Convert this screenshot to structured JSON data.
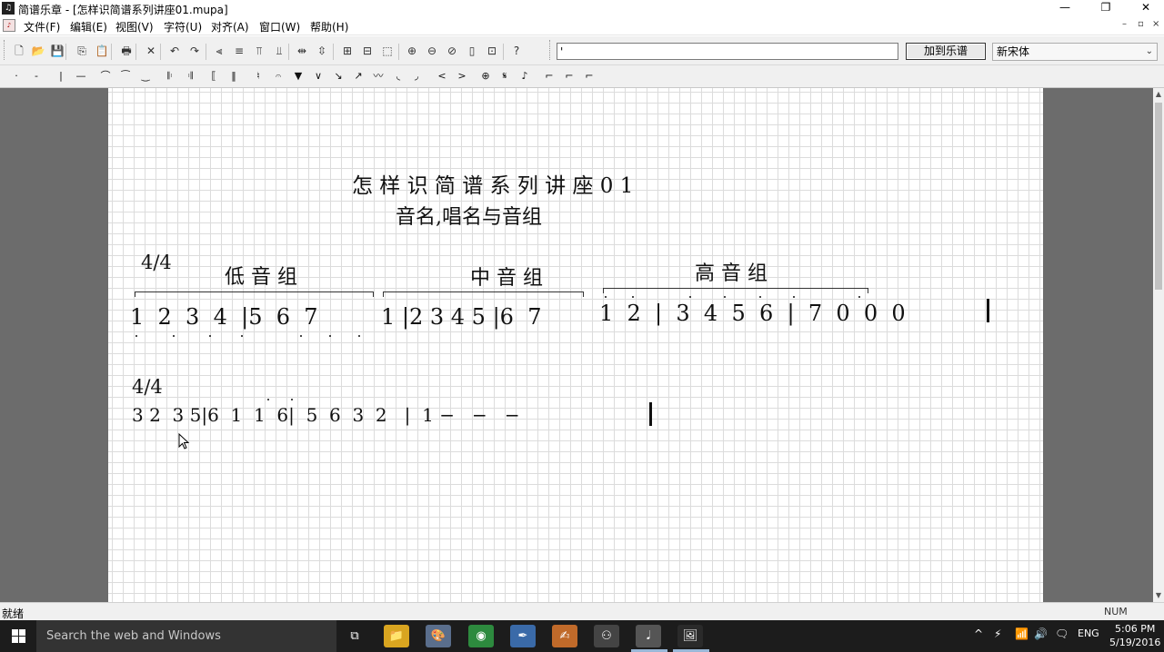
{
  "window": {
    "title": "简谱乐章 - [怎样识简谱系列讲座01.mupa]",
    "app_icon": "app-logo-icon",
    "controls": {
      "minimize": "—",
      "restore": "❐",
      "close": "✕"
    }
  },
  "menu": {
    "items": [
      "文件(F)",
      "编辑(E)",
      "视图(V)",
      "字符(U)",
      "对齐(A)",
      "窗口(W)",
      "帮助(H)"
    ],
    "mdi": {
      "minimize": "–",
      "restore": "▫",
      "close": "×"
    }
  },
  "toolbar1": {
    "icons": [
      "new-file-icon",
      "open-folder-icon",
      "save-icon",
      "copy-icon",
      "paste-icon",
      "print-icon",
      "delete-icon",
      "undo-icon",
      "redo-icon",
      "align-left-icon",
      "align-center-icon",
      "align-top-icon",
      "align-bottom-icon",
      "distribute-h-icon",
      "distribute-v-icon",
      "group-icon",
      "ungroup-icon",
      "select-all-icon",
      "zoom-in-icon",
      "zoom-out-icon",
      "zoom-reset-icon",
      "page-icon",
      "fit-icon",
      "help-icon"
    ],
    "glyphs": [
      "🗋",
      "📂",
      "💾",
      "⎘",
      "📋",
      "🖶",
      "✕",
      "↶",
      "↷",
      "⫷",
      "≡",
      "⫪",
      "⫫",
      "⇹",
      "⇳",
      "⊞",
      "⊟",
      "⬚",
      "⊕",
      "⊖",
      "⊘",
      "▯",
      "⊡",
      "?"
    ],
    "text_input_value": "'",
    "add_button_label": "加到乐谱",
    "font_select_value": "新宋体"
  },
  "toolbar2": {
    "symbols": [
      "·",
      "-",
      "|",
      "—",
      "⌒",
      "⁀",
      "‿",
      "𝄆",
      "𝄇",
      "⟦",
      "‖",
      "♮",
      "𝄐",
      "▼",
      "∨",
      "↘",
      "↗",
      "〰",
      "◟",
      "◞",
      "<",
      ">",
      "⊕",
      "𝄋",
      "♪",
      "⌐",
      "⌐",
      "⌐"
    ]
  },
  "score": {
    "title": "怎 样 识 简 谱 系 列 讲 座 0 1",
    "subtitle": "音名,唱名与音组",
    "time_sig_1": "4/4",
    "group_low": "低 音 组",
    "group_mid": "中 音 组",
    "group_high": "高 音 组",
    "line1": {
      "low": "1  2  3  4  |5  6  7",
      "mid": "1 |2 3 4 5 |6  7",
      "high": "1  2  |  3  4  5  6  |  7  0  0  0"
    },
    "time_sig_2": "4/4",
    "line2": "3 2  3 5|6  1  1  6|  5  6  3  2   |  1 −   −   −"
  },
  "status": {
    "text": "就绪",
    "num": "NUM"
  },
  "taskbar": {
    "search_placeholder": "Search the web and Windows",
    "apps": [
      "task-view-icon",
      "file-explorer-icon",
      "paint-icon",
      "chrome-icon",
      "pen-tool-icon",
      "handwriting-icon",
      "media-icon",
      "jianpu-app-icon",
      "photos-icon"
    ],
    "app_glyphs": [
      "⧉",
      "📁",
      "🎨",
      "◉",
      "✒",
      "✍",
      "⚇",
      "𝅘𝅥",
      "🖼"
    ],
    "tray": {
      "chevron": "^",
      "network": "⚡",
      "wifi": "📶",
      "volume": "🔊",
      "notifications": "🗨",
      "language": "ENG"
    },
    "time": "5:06 PM",
    "date": "5/19/2016"
  }
}
